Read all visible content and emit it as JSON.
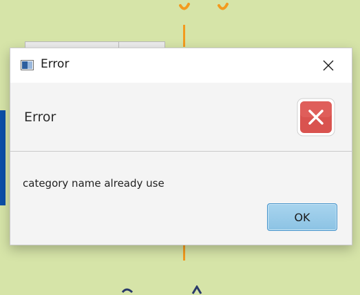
{
  "dialog": {
    "title": "Error",
    "header": "Error",
    "content": "category name already use",
    "ok_label": "OK",
    "title_icon": "window-icon",
    "header_icon": "error-x-icon",
    "close_icon": "close-icon"
  },
  "colors": {
    "background": "#d6e4a8",
    "accent_orange": "#f39a1e",
    "error_red": "#d9534f",
    "ok_blue": "#8cc3e4"
  }
}
